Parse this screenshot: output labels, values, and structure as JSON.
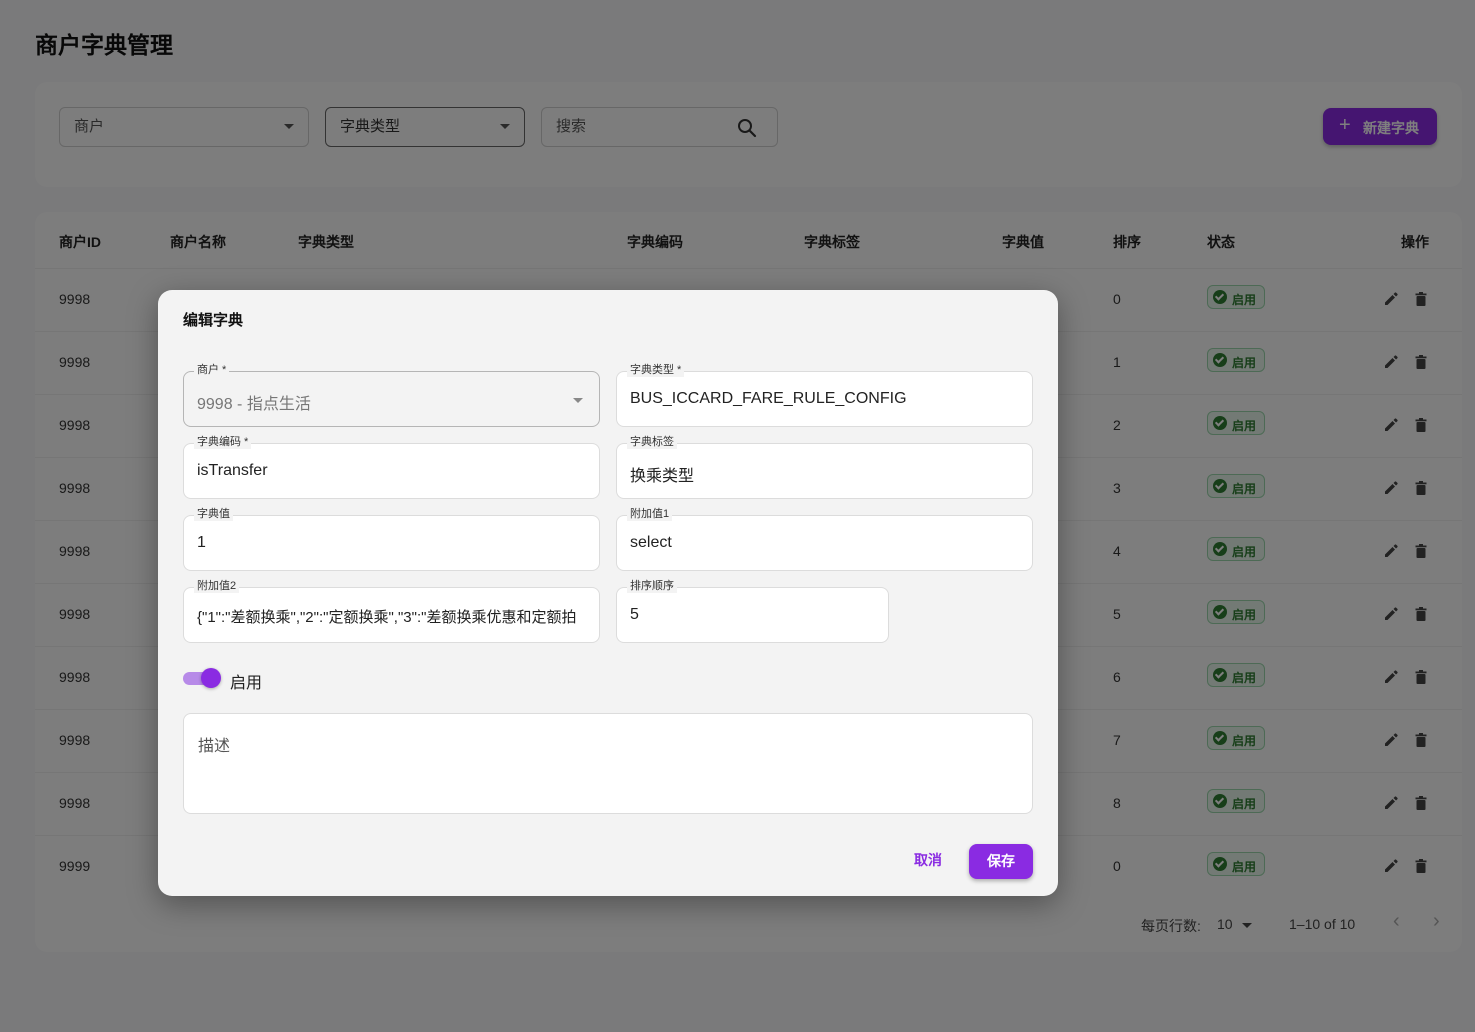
{
  "page": {
    "title": "商户字典管理"
  },
  "filters": {
    "merchant_placeholder": "商户",
    "dict_type_placeholder": "字典类型",
    "search_placeholder": "搜索",
    "new_button_label": "新建字典"
  },
  "table": {
    "headers": {
      "merchant_id": "商户ID",
      "merchant_name": "商户名称",
      "dict_type": "字典类型",
      "dict_code": "字典编码",
      "dict_label": "字典标签",
      "dict_value": "字典值",
      "sort": "排序",
      "status": "状态",
      "actions": "操作"
    },
    "rows": [
      {
        "merchant_id": "9998",
        "sort": "0",
        "status": "启用"
      },
      {
        "merchant_id": "9998",
        "sort": "1",
        "status": "启用"
      },
      {
        "merchant_id": "9998",
        "sort": "2",
        "status": "启用"
      },
      {
        "merchant_id": "9998",
        "sort": "3",
        "status": "启用"
      },
      {
        "merchant_id": "9998",
        "sort": "4",
        "status": "启用"
      },
      {
        "merchant_id": "9998",
        "sort": "5",
        "status": "启用"
      },
      {
        "merchant_id": "9998",
        "sort": "6",
        "status": "启用"
      },
      {
        "merchant_id": "9998",
        "sort": "7",
        "status": "启用"
      },
      {
        "merchant_id": "9998",
        "sort": "8",
        "status": "启用"
      },
      {
        "merchant_id": "9999",
        "sort": "0",
        "status": "启用"
      }
    ],
    "pagination": {
      "rows_per_page_label": "每页行数:",
      "rows_per_page_value": "10",
      "range_text": "1–10 of 10"
    }
  },
  "modal": {
    "title": "编辑字典",
    "fields": {
      "merchant": {
        "label": "商户 *",
        "value": "9998 - 指点生活"
      },
      "dict_type": {
        "label": "字典类型 *",
        "value": "BUS_ICCARD_FARE_RULE_CONFIG"
      },
      "dict_code": {
        "label": "字典编码 *",
        "value": "isTransfer"
      },
      "dict_label": {
        "label": "字典标签",
        "value": "换乘类型"
      },
      "dict_value": {
        "label": "字典值",
        "value": "1"
      },
      "extra_value1": {
        "label": "附加值1",
        "value": "select"
      },
      "extra_value2": {
        "label": "附加值2",
        "value": "{\"1\":\"差额换乘\",\"2\":\"定额换乘\",\"3\":\"差额换乘优惠和定额拍"
      },
      "sort_order": {
        "label": "排序顺序",
        "value": "5"
      }
    },
    "enabled_label": "启用",
    "enabled": true,
    "description_placeholder": "描述",
    "cancel_label": "取消",
    "save_label": "保存"
  },
  "colors": {
    "accent": "#8a2be2",
    "status_green": "#2e7d32"
  }
}
